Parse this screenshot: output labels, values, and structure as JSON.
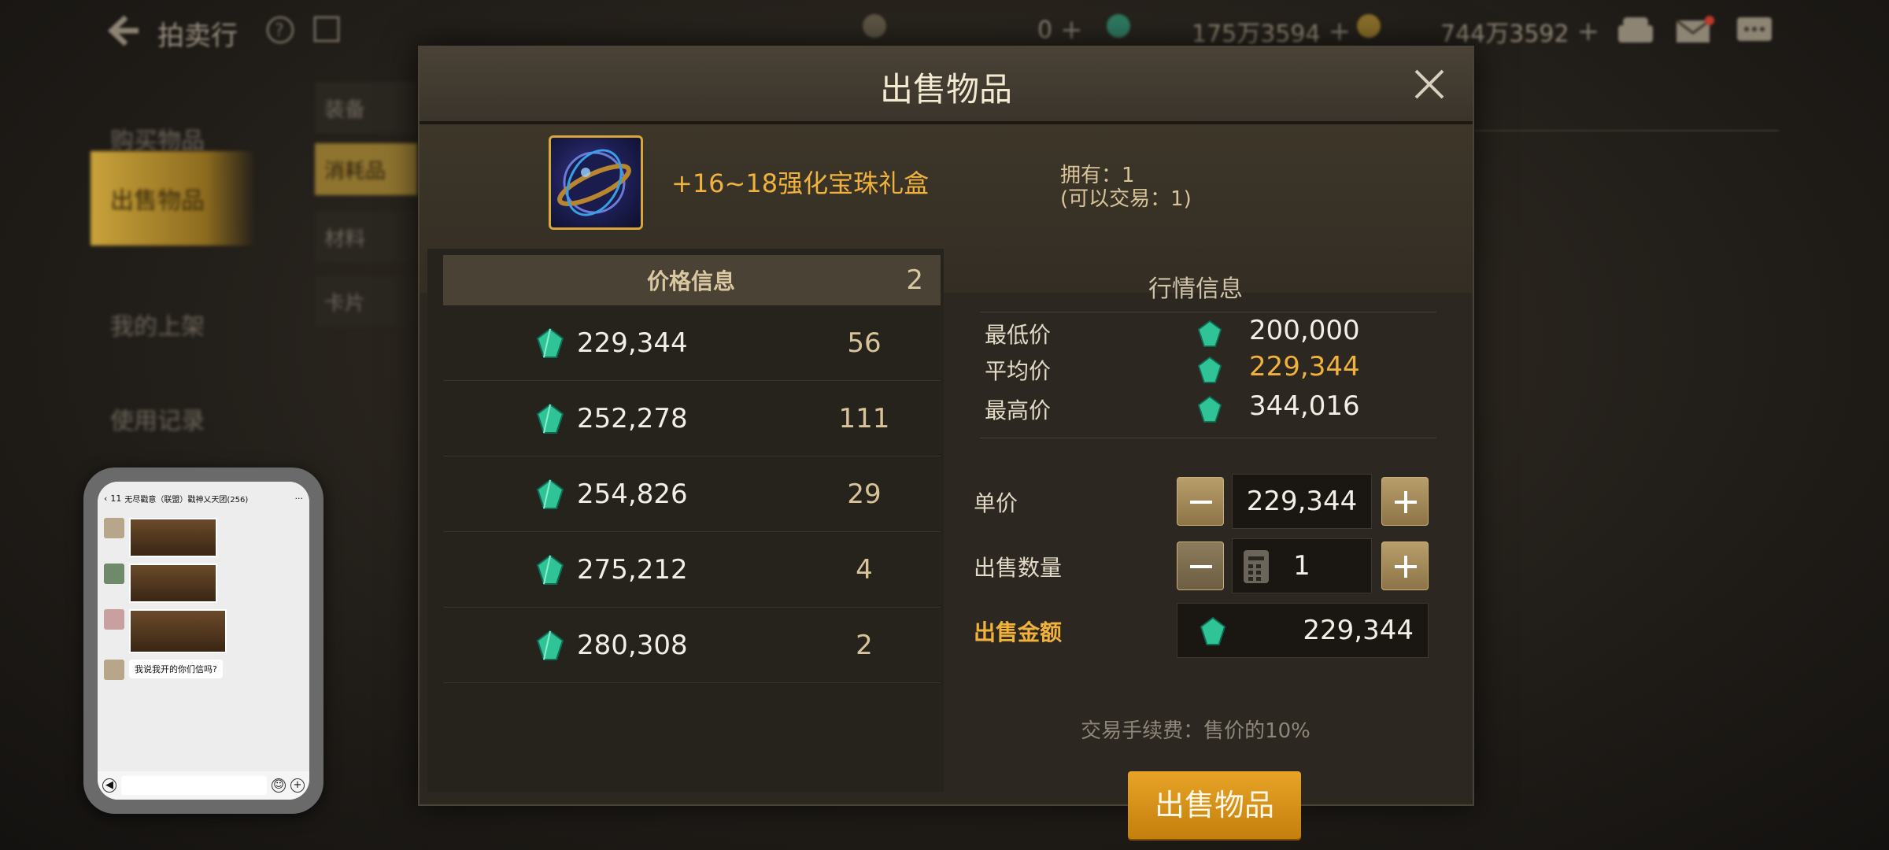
{
  "topbar": {
    "title": "拍卖行",
    "currency_a": "0",
    "currency_b": "175万3594",
    "currency_c": "744万3592"
  },
  "sidebar": {
    "items": [
      {
        "label": "购买物品"
      },
      {
        "label": "出售物品"
      },
      {
        "label": "我的上架"
      },
      {
        "label": "使用记录"
      }
    ],
    "sub_items": [
      {
        "label": "装备"
      },
      {
        "label": "消耗品"
      },
      {
        "label": "材料"
      },
      {
        "label": "卡片"
      }
    ]
  },
  "dialog": {
    "title": "出售物品",
    "item": {
      "name": "+16~18强化宝珠礼盒",
      "owned": "拥有：1",
      "tradable": "(可以交易：1)"
    },
    "price_info": {
      "header": "价格信息",
      "page": "2",
      "rows": [
        {
          "price": "229,344",
          "count": "56"
        },
        {
          "price": "252,278",
          "count": "111"
        },
        {
          "price": "254,826",
          "count": "29"
        },
        {
          "price": "275,212",
          "count": "4"
        },
        {
          "price": "280,308",
          "count": "2"
        }
      ]
    },
    "market": {
      "header": "行情信息",
      "min_label": "最低价",
      "min_value": "200,000",
      "avg_label": "平均价",
      "avg_value": "229,344",
      "max_label": "最高价",
      "max_value": "344,016"
    },
    "form": {
      "unit_price_label": "单价",
      "unit_price_value": "229,344",
      "quantity_label": "出售数量",
      "quantity_value": "1",
      "total_label": "出售金额",
      "total_value": "229,344",
      "fee_text": "交易手续费：售价的10%",
      "sell_button": "出售物品"
    }
  },
  "chat_overlay": {
    "title": "无尽戳意（联盟）戳神乂天团(256)",
    "unread": "11",
    "message": "我说我开的你们信吗?"
  },
  "colors": {
    "accent_gold": "#f0b23c",
    "sell_button": "#d9910f",
    "gem": "#3ad1a0"
  }
}
